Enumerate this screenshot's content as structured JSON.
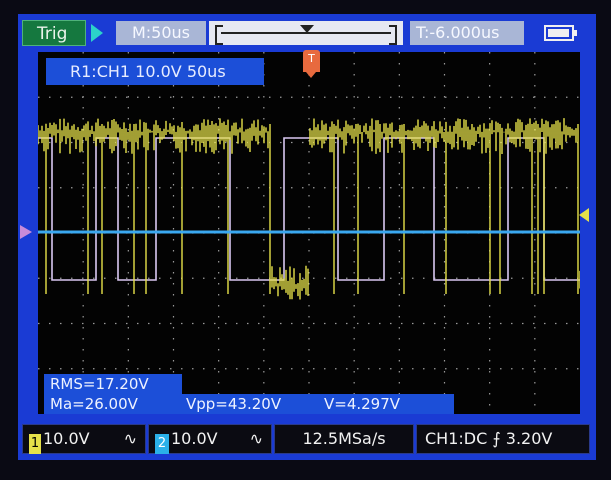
{
  "top_bar": {
    "trigger_button": "Trig",
    "timebase": "M:50us",
    "trigger_offset": "T:-6.000us"
  },
  "ref_label": "R1:CH1 10.0V 50us",
  "trigger_marker": "T",
  "measurements": {
    "rms": "RMS=17.20V",
    "mean": "Ma=26.00V",
    "vpp": "Vpp=43.20V",
    "v": "V=4.297V"
  },
  "bottom_bar": {
    "ch1_badge": "1",
    "ch1_scale": "10.0V",
    "ch1_coupling": "∿",
    "ch2_badge": "2",
    "ch2_scale": "10.0V",
    "ch2_coupling": "∿",
    "sample_rate": "12.5MSa/s",
    "trigger_info": "CH1:DC ⨍ 3.20V"
  },
  "colors": {
    "ch1_trace": "#e6e24a",
    "ref_trace": "#d9c8f2",
    "ch2_trace": "#3aa8f0",
    "screen_frame": "#1a3bd4"
  },
  "icons": [
    "play-icon",
    "battery-icon",
    "trigger-marker-icon",
    "ch1-ground-marker-icon",
    "trigger-level-icon"
  ]
}
